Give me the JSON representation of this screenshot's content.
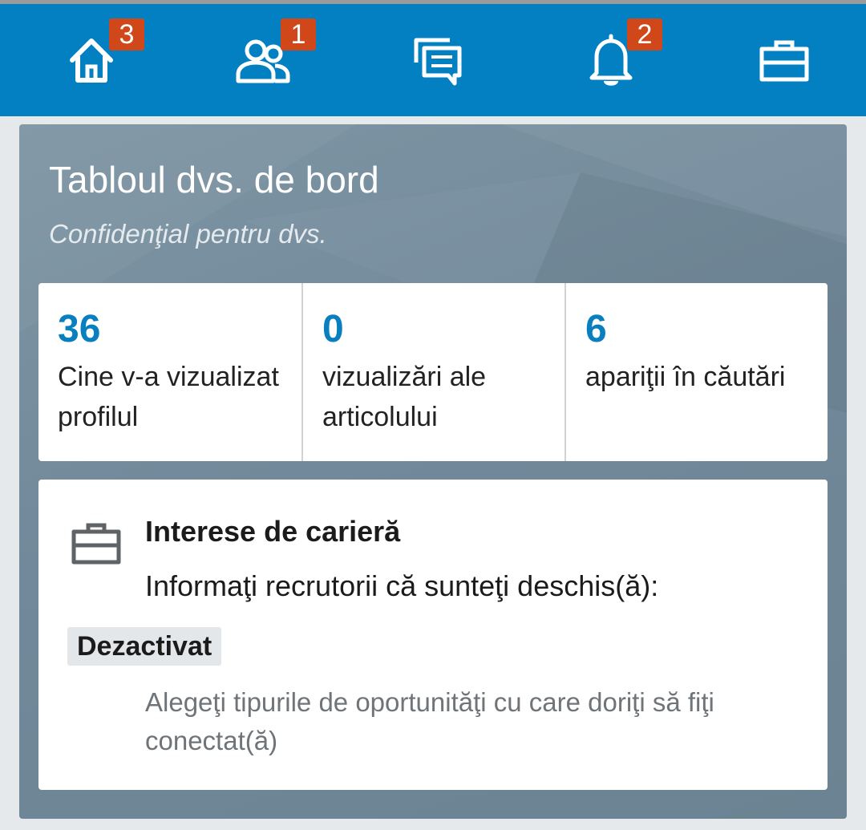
{
  "nav": {
    "home": {
      "icon": "home-icon",
      "badge": "3"
    },
    "network": {
      "icon": "people-icon",
      "badge": "1"
    },
    "messages": {
      "icon": "messages-icon"
    },
    "notifications": {
      "icon": "bell-icon",
      "badge": "2"
    },
    "jobs": {
      "icon": "briefcase-icon"
    }
  },
  "colors": {
    "nav_bg": "#0380c2",
    "badge_bg": "#d0471a",
    "stat_number": "#0a7fbf",
    "dashboard_bg": "#71899a"
  },
  "dashboard": {
    "title": "Tabloul dvs. de bord",
    "subtitle": "Confidenţial pentru dvs.",
    "stats": [
      {
        "number": "36",
        "label": "Cine v-a vizualizat profilul"
      },
      {
        "number": "0",
        "label": "vizualizări ale articolului"
      },
      {
        "number": "6",
        "label": "apariţii în căutări"
      }
    ]
  },
  "career": {
    "icon": "briefcase-icon",
    "title": "Interese de carieră",
    "description": "Informaţi recrutorii că sunteţi deschis(ă):",
    "status": "Dezactivat",
    "link": "Alegeţi tipurile de oportunităţi cu care doriţi să fiţi conectat(ă)"
  }
}
